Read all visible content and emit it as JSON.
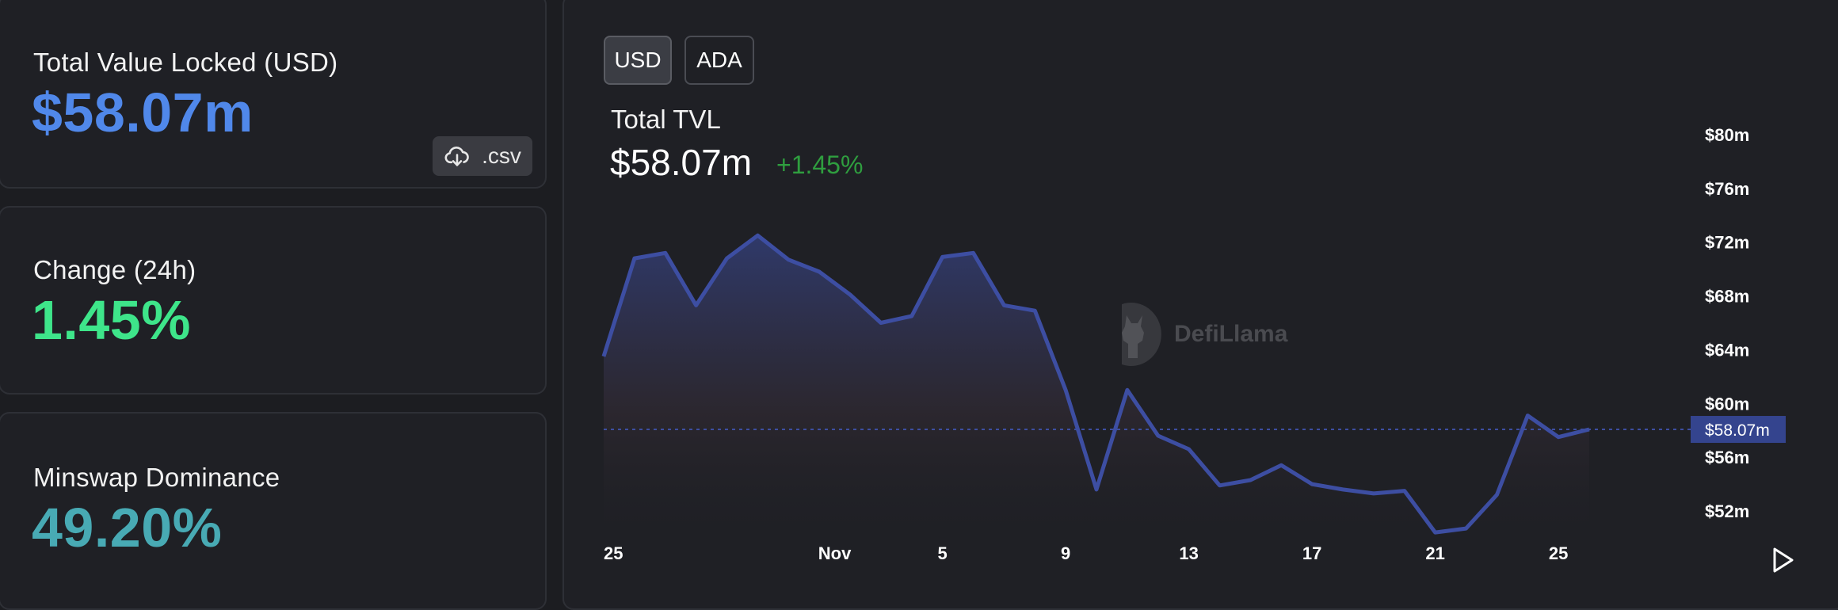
{
  "stats": {
    "tvl": {
      "label": "Total Value Locked (USD)",
      "value": "$58.07m",
      "color": "#5088ea"
    },
    "change": {
      "label": "Change (24h)",
      "value": "1.45%",
      "color": "#3ee58a"
    },
    "dominance": {
      "label": "Minswap Dominance",
      "value": "49.20%",
      "color": "#48aab4"
    }
  },
  "csv_button": {
    "label": ".csv",
    "icon": "cloud-download-icon"
  },
  "toggles": {
    "usd": "USD",
    "ada": "ADA"
  },
  "chart_header": {
    "title": "Total TVL",
    "value": "$58.07m",
    "change": "+1.45%"
  },
  "watermark": "DefiLlama",
  "chart_data": {
    "type": "area",
    "title": "Total TVL",
    "x_tick_labels": [
      "25",
      "Nov",
      "5",
      "9",
      "13",
      "17",
      "21",
      "25"
    ],
    "x": [
      0,
      1,
      2,
      3,
      4,
      5,
      6,
      7,
      8,
      9,
      10,
      11,
      12,
      13,
      14,
      15,
      16,
      17,
      18,
      19,
      20,
      21,
      22,
      23,
      24,
      25,
      26,
      27,
      28,
      29,
      30,
      31,
      32
    ],
    "values": [
      63.5,
      70.8,
      71.2,
      67.3,
      70.8,
      72.5,
      70.7,
      69.8,
      68.1,
      66.0,
      66.5,
      70.9,
      71.2,
      67.3,
      66.9,
      61.0,
      53.6,
      61.0,
      57.6,
      56.6,
      53.9,
      54.3,
      55.4,
      54.0,
      53.6,
      53.3,
      53.5,
      50.4,
      50.7,
      53.2,
      59.1,
      57.5,
      58.07
    ],
    "y_tick_labels": [
      "$80m",
      "$76m",
      "$72m",
      "$68m",
      "$64m",
      "$60m",
      "$56m",
      "$52m"
    ],
    "y_ticks": [
      80,
      76,
      72,
      68,
      64,
      60,
      56,
      52
    ],
    "ylim": [
      50,
      82
    ],
    "current_value_label": "$58.07m",
    "current_value": 58.07,
    "line_color": "#3d4ea2",
    "marker_color": "#34448e"
  }
}
